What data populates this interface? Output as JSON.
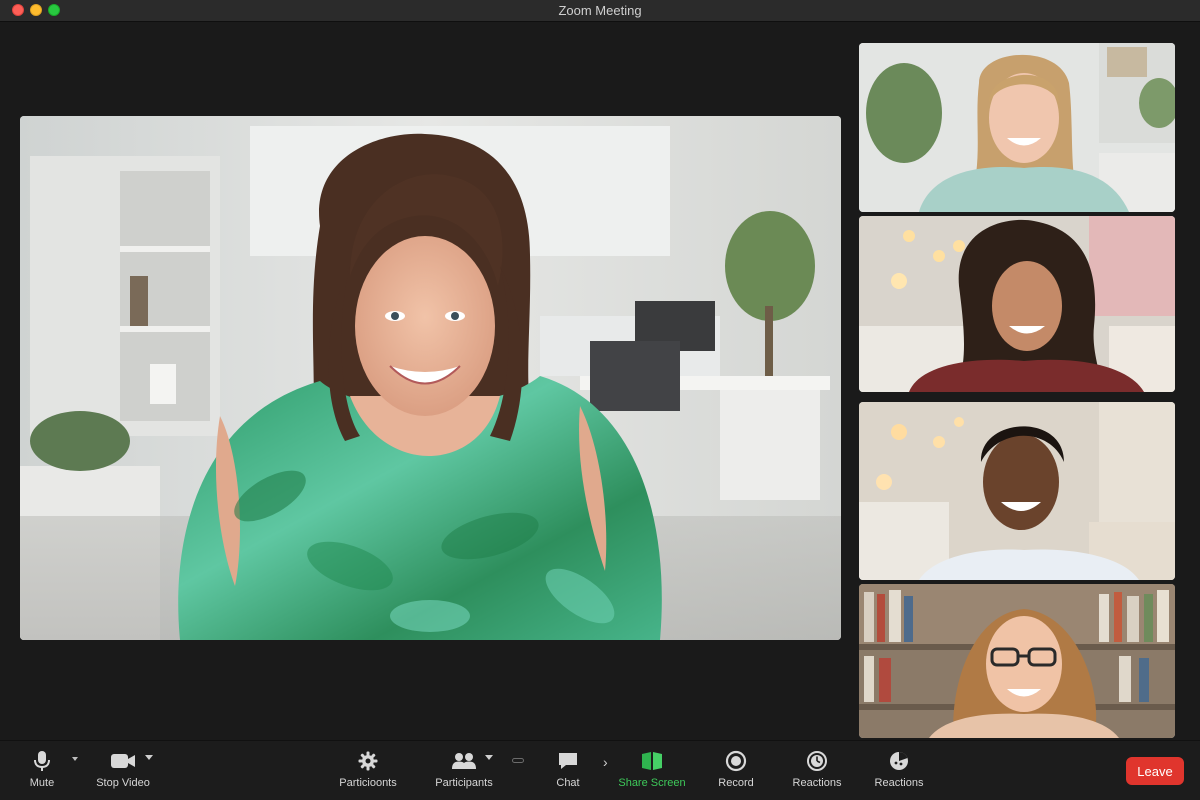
{
  "window": {
    "title": "Zoom Meeting"
  },
  "toolbar": {
    "mute_label": "Mute",
    "stop_video_label": "Stop Video",
    "participants_label_1": "Particioonts",
    "participants_label_2": "Participants",
    "chat_label": "Chat",
    "share_screen_label": "Share Screen",
    "record_label": "Record",
    "reactions_label_1": "Reactions",
    "reactions_label_2": "Reactions",
    "leave_label": "Leave"
  },
  "icons": {
    "mic": "microphone-icon",
    "video": "video-camera-icon",
    "participants_settings": "gear-icon",
    "participants": "people-icon",
    "chat": "chat-bubble-icon",
    "share": "share-screen-icon",
    "record": "record-icon",
    "reactions": "clock-icon",
    "reactions2": "reaction-icon"
  },
  "colors": {
    "share_screen_accent": "#3ec95a",
    "leave_button": "#e0352d",
    "toolbar_bg": "#1c1c1c"
  },
  "participants": [
    {
      "position": "main-speaker"
    },
    {
      "position": "thumbnail-1"
    },
    {
      "position": "thumbnail-2"
    },
    {
      "position": "thumbnail-3"
    },
    {
      "position": "thumbnail-4"
    }
  ]
}
